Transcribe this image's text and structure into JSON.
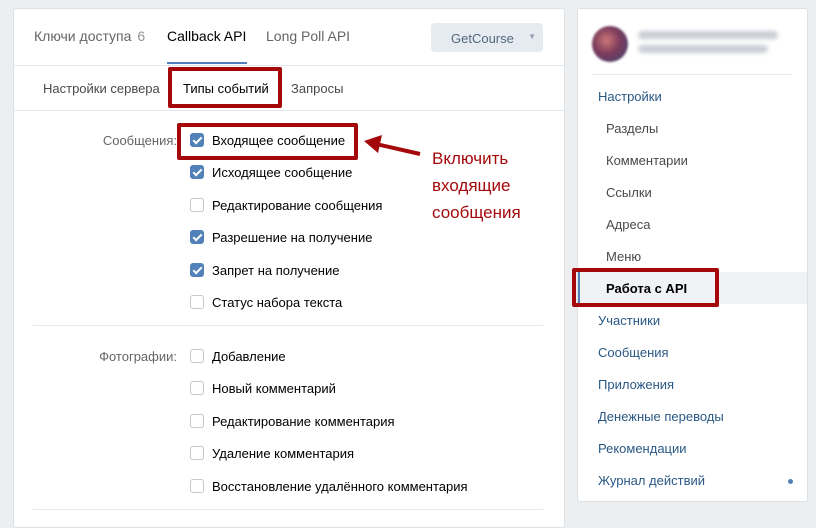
{
  "tabs": {
    "access_keys": "Ключи доступа",
    "access_keys_count": "6",
    "callback_api": "Callback API",
    "long_poll_api": "Long Poll API"
  },
  "dropdown": {
    "value": "GetCourse"
  },
  "subtabs": {
    "server_settings": "Настройки сервера",
    "event_types": "Типы событий",
    "requests": "Запросы"
  },
  "messages": {
    "label": "Сообщения:",
    "items": [
      {
        "label": "Входящее сообщение",
        "checked": true
      },
      {
        "label": "Исходящее сообщение",
        "checked": true
      },
      {
        "label": "Редактирование сообщения",
        "checked": false
      },
      {
        "label": "Разрешение на получение",
        "checked": true
      },
      {
        "label": "Запрет на получение",
        "checked": true
      },
      {
        "label": "Статус набора текста",
        "checked": false
      }
    ]
  },
  "photos": {
    "label": "Фотографии:",
    "items": [
      {
        "label": "Добавление",
        "checked": false
      },
      {
        "label": "Новый комментарий",
        "checked": false
      },
      {
        "label": "Редактирование комментария",
        "checked": false
      },
      {
        "label": "Удаление комментария",
        "checked": false
      },
      {
        "label": "Восстановление удалённого комментария",
        "checked": false
      }
    ]
  },
  "annotation": {
    "line1": "Включить",
    "line2": "входящие",
    "line3": "сообщения"
  },
  "sidebar": {
    "settings": "Настройки",
    "sub_items": [
      "Разделы",
      "Комментарии",
      "Ссылки",
      "Адреса",
      "Меню",
      "Работа с API"
    ],
    "items": [
      "Участники",
      "Сообщения",
      "Приложения",
      "Денежные переводы",
      "Рекомендации",
      "Журнал действий"
    ]
  },
  "colors": {
    "accent": "#5181b8",
    "highlight": "#a5080b",
    "link": "#2a5885"
  }
}
